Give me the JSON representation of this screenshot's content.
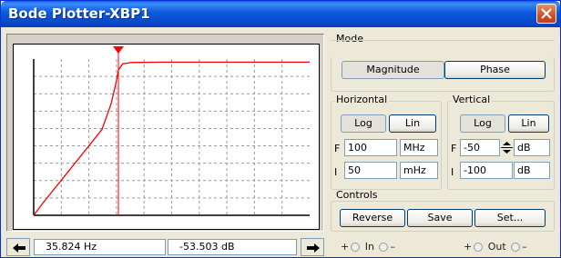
{
  "window": {
    "title": "Bode Plotter-XBP1"
  },
  "mode": {
    "label": "Mode",
    "magnitude": "Magnitude",
    "phase": "Phase"
  },
  "horizontal": {
    "label": "Horizontal",
    "log": "Log",
    "lin": "Lin",
    "f_label": "F",
    "f_value": "100",
    "f_unit": "MHz",
    "i_label": "I",
    "i_value": "50",
    "i_unit": "mHz"
  },
  "vertical": {
    "label": "Vertical",
    "log": "Log",
    "lin": "Lin",
    "f_label": "F",
    "f_value": "-50",
    "f_unit": "dB",
    "i_label": "I",
    "i_value": "-100",
    "i_unit": "dB"
  },
  "controls": {
    "label": "Controls",
    "reverse": "Reverse",
    "save": "Save",
    "set": "Set..."
  },
  "readout": {
    "frequency": "35.824  Hz",
    "magnitude": "-53.503  dB"
  },
  "io": {
    "in_plus": "+",
    "in_label": "In",
    "in_minus": "–",
    "out_plus": "+",
    "out_label": "Out",
    "out_minus": "–"
  },
  "colors": {
    "trace": "#FF0000",
    "cursor": "#FF0000",
    "titlebar": "#0A58DC"
  },
  "chart_data": {
    "type": "line",
    "x_scale": "log",
    "xlim": [
      "50 mHz",
      "100 MHz"
    ],
    "ylim": [
      -100,
      -50
    ],
    "y_unit": "dB",
    "cursor": {
      "x": 35.824,
      "y": -53.503
    },
    "series": [
      {
        "points": [
          [
            0.05,
            -100
          ],
          [
            0.1,
            -96.2
          ],
          [
            1,
            -84.4
          ],
          [
            10,
            -72.5
          ],
          [
            20,
            -64.5
          ],
          [
            30,
            -57.5
          ],
          [
            35.824,
            -53.503
          ],
          [
            50,
            -51.5
          ],
          [
            100,
            -51.1
          ],
          [
            1000,
            -51.0
          ],
          [
            100000000,
            -51.0
          ]
        ]
      }
    ]
  }
}
